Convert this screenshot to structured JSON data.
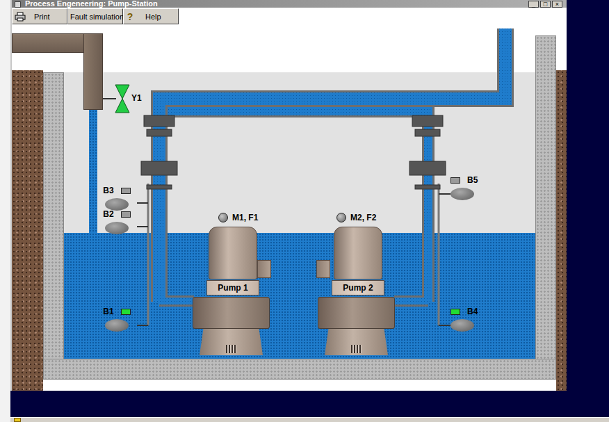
{
  "window": {
    "title": "Process Engeneering: Pump-Station",
    "controls": [
      "_",
      "□",
      "×"
    ]
  },
  "toolbar": [
    {
      "label": "Print",
      "kind": "printer",
      "glyph": ""
    },
    {
      "label": "Fault simulation",
      "kind": "plain",
      "glyph": ""
    },
    {
      "label": "Help",
      "kind": "glyph",
      "glyph": "?"
    }
  ],
  "inflow": {
    "on": true
  },
  "valve": {
    "label": "Y1",
    "open": true
  },
  "basin": {
    "level": 0.44
  },
  "sensors": [
    {
      "label": "B3",
      "active": false
    },
    {
      "label": "B2",
      "active": false
    },
    {
      "label": "B1",
      "active": true
    },
    {
      "label": "B4",
      "active": true
    },
    {
      "label": "B5",
      "active": false
    }
  ],
  "motors": [
    {
      "label": "M1, F1",
      "running": false
    },
    {
      "label": "M2, F2",
      "running": false
    }
  ],
  "pumps": [
    {
      "label": "Pump 1"
    },
    {
      "label": "Pump 2"
    }
  ]
}
